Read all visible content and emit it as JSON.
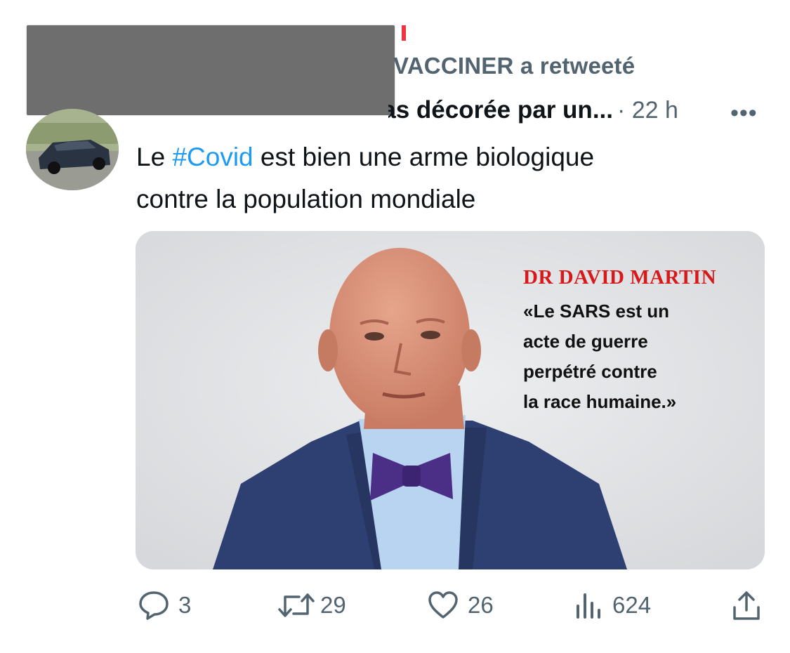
{
  "retweet": {
    "text": "VACCINER a retweeté"
  },
  "tweet": {
    "display_name": "La vie n'est pas décorée par un...",
    "time": "· 22 h",
    "text_prefix": "Le ",
    "hashtag": "#Covid",
    "text_line1_rest": " est bien une arme biologique",
    "text_line2": "contre la population mondiale"
  },
  "media": {
    "caption_name": "DR DAVID MARTIN",
    "quote_lines": [
      "«Le SARS est un",
      "acte de guerre",
      "perpétré contre",
      "la race humaine.»"
    ]
  },
  "actions": {
    "replies": "3",
    "retweets": "29",
    "likes": "26",
    "views": "624"
  },
  "more_label": "•••",
  "colors": {
    "accent": "#1d9bf0",
    "muted": "#536471",
    "caption_red": "#d7191a"
  }
}
